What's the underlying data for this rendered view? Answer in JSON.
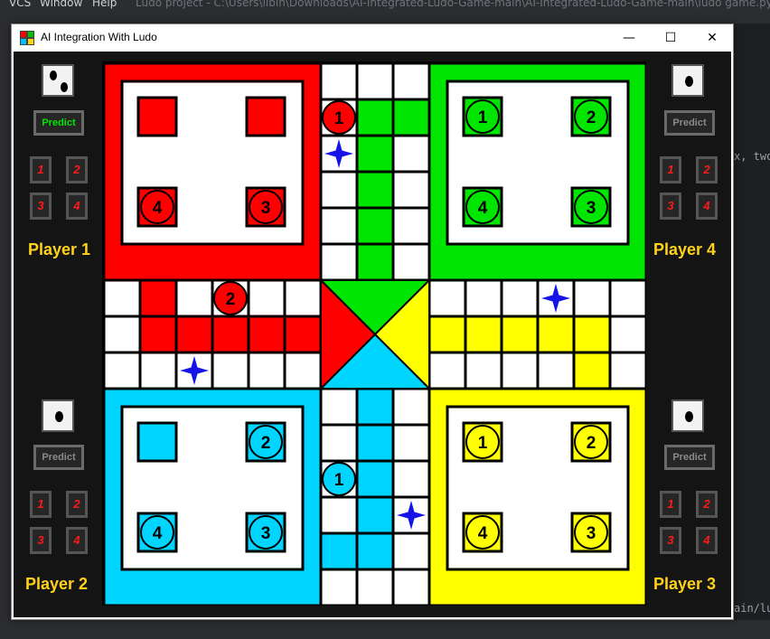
{
  "ide": {
    "menu": [
      "VCS",
      "Window",
      "Help"
    ],
    "path": "Ludo project - C:\\Users\\libin\\Downloads\\AI-Integrated-Ludo-Game-main\\AI-Integrated-Ludo-Game-main\\ludo game.py",
    "code_right_1": "x, two_",
    "code_right_2": "ain/lu"
  },
  "window": {
    "title": "AI Integration With Ludo",
    "minimize_glyph": "—",
    "maximize_glyph": "☐",
    "close_glyph": "✕"
  },
  "colors": {
    "red": "#ff0000",
    "green": "#00e600",
    "yellow": "#ffff00",
    "blue": "#00d5ff",
    "star": "#1414e6",
    "label": "#ffd21a"
  },
  "players": {
    "p1": {
      "label": "Player 1",
      "dice_face": 2,
      "predict_label": "Predict",
      "predict_active": true,
      "token_buttons": [
        "1",
        "2",
        "3",
        "4"
      ]
    },
    "p2": {
      "label": "Player 2",
      "dice_face": 1,
      "predict_label": "Predict",
      "predict_active": false,
      "token_buttons": [
        "1",
        "2",
        "3",
        "4"
      ]
    },
    "p3": {
      "label": "Player 3",
      "dice_face": 1,
      "predict_label": "Predict",
      "predict_active": false,
      "token_buttons": [
        "1",
        "2",
        "3",
        "4"
      ]
    },
    "p4": {
      "label": "Player 4",
      "dice_face": 1,
      "predict_label": "Predict",
      "predict_active": false,
      "token_buttons": [
        "1",
        "2",
        "3",
        "4"
      ]
    }
  },
  "tokens": {
    "red": {
      "home": [
        "",
        "",
        "4",
        "3"
      ],
      "track": [
        "1",
        "2"
      ]
    },
    "green": {
      "home": [
        "1",
        "2",
        "4",
        "3"
      ],
      "track": []
    },
    "yellow": {
      "home": [
        "1",
        "2",
        "4",
        "3"
      ],
      "track": []
    },
    "blue": {
      "home": [
        "",
        "2",
        "4",
        "3"
      ],
      "track": [
        "1"
      ]
    }
  }
}
